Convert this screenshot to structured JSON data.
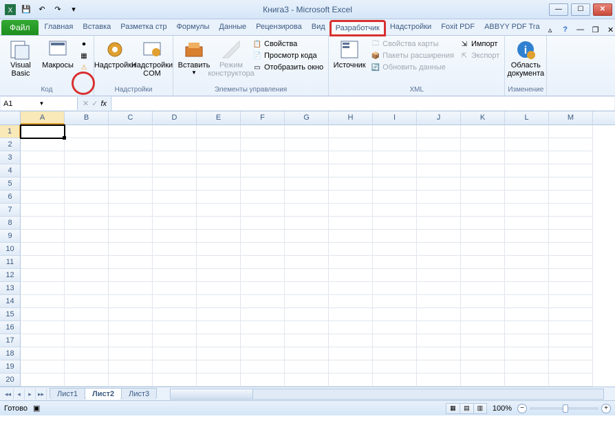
{
  "title": "Книга3 - Microsoft Excel",
  "qat": {
    "save": "💾",
    "undo": "↶",
    "redo": "↷"
  },
  "tabs": {
    "file": "Файл",
    "items": [
      "Главная",
      "Вставка",
      "Разметка стр",
      "Формулы",
      "Данные",
      "Рецензирова",
      "Вид",
      "Разработчик",
      "Надстройки",
      "Foxit PDF",
      "ABBYY PDF Tra"
    ],
    "active_index": 7
  },
  "ribbon": {
    "code": {
      "label": "Код",
      "vb": "Visual\nBasic",
      "macros": "Макросы"
    },
    "addins": {
      "label": "Надстройки",
      "addins": "Надстройки",
      "com": "Надстройки\nCOM"
    },
    "controls": {
      "label": "Элементы управления",
      "insert": "Вставить",
      "design": "Режим\nконструктора",
      "props": "Свойства",
      "code": "Просмотр кода",
      "dialog": "Отобразить окно"
    },
    "xml": {
      "label": "XML",
      "source": "Источник",
      "mapprops": "Свойства карты",
      "expansion": "Пакеты расширения",
      "refresh": "Обновить данные",
      "import": "Импорт",
      "export": "Экспорт"
    },
    "modify": {
      "label": "Изменение",
      "docpanel": "Область\nдокумента"
    }
  },
  "formula": {
    "name": "A1",
    "fx": "fx"
  },
  "columns": [
    "A",
    "B",
    "C",
    "D",
    "E",
    "F",
    "G",
    "H",
    "I",
    "J",
    "K",
    "L",
    "M"
  ],
  "rows": 20,
  "active_cell": {
    "row": 1,
    "col": 0
  },
  "sheets": {
    "items": [
      "Лист1",
      "Лист2",
      "Лист3"
    ],
    "active": 1
  },
  "status": {
    "ready": "Готово",
    "zoom": "100%"
  }
}
